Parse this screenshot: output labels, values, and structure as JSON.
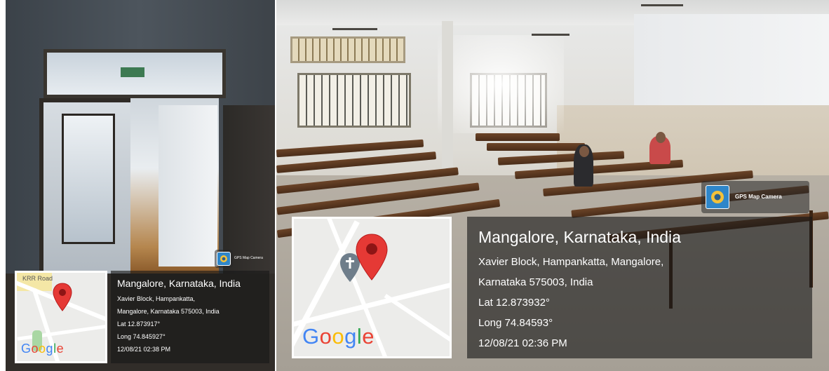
{
  "left_photo": {
    "map": {
      "road_label": "KRR Road",
      "logo": "Google",
      "pin_color": "#e53935"
    },
    "app_badge": {
      "label": "GPS Map Camera",
      "icon": "gps-map-camera-icon"
    },
    "info": {
      "title": "Mangalore, Karnataka, India",
      "address_line1": "Xavier Block, Hampankatta,",
      "address_line2": "Mangalore, Karnataka 575003, India",
      "lat": "Lat 12.873917°",
      "long": "Long 74.845927°",
      "datetime": "12/08/21 02:38 PM"
    }
  },
  "right_photo": {
    "map": {
      "logo": "Google",
      "pin_color": "#e53935",
      "place_marker": "church-marker-icon"
    },
    "app_badge": {
      "label": "GPS Map Camera",
      "icon": "gps-map-camera-icon"
    },
    "info": {
      "title": "Mangalore, Karnataka, India",
      "address_line1": "Xavier Block, Hampankatta, Mangalore,",
      "address_line2": "Karnataka 575003, India",
      "lat": "Lat 12.873932°",
      "long": "Long 74.84593°",
      "datetime": "12/08/21 02:36 PM"
    }
  }
}
